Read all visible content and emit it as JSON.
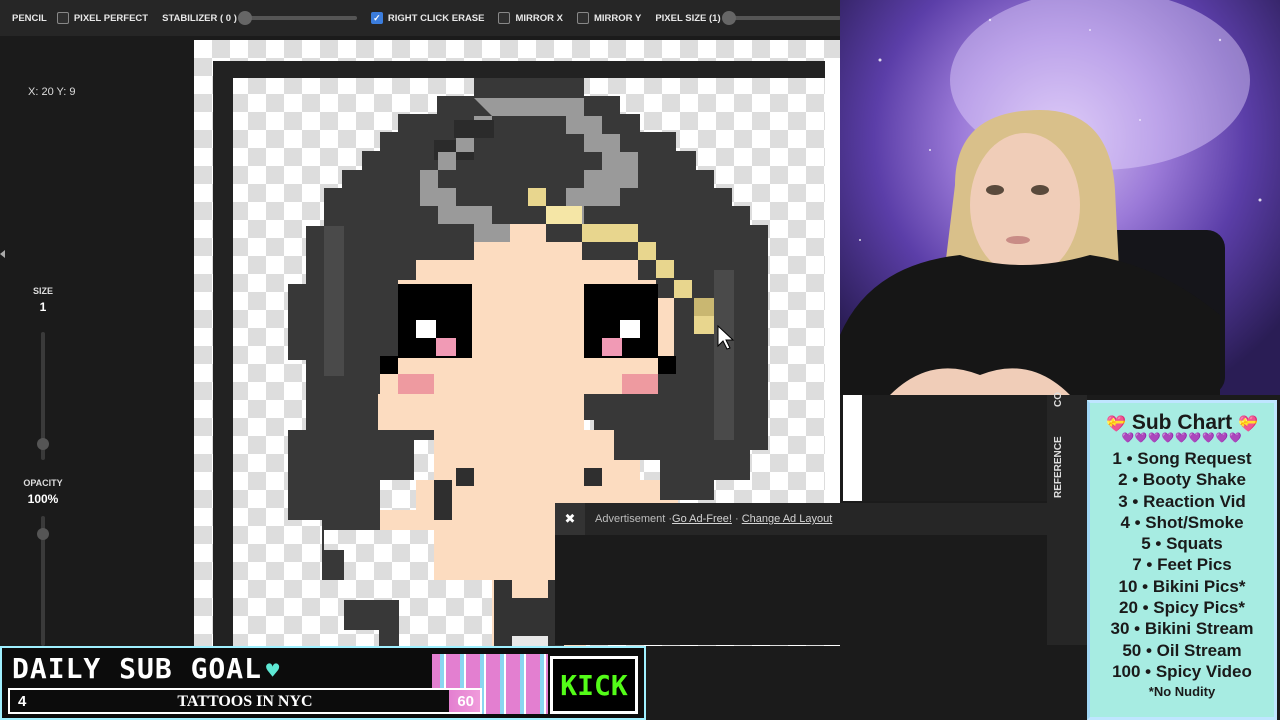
{
  "toolbar": {
    "tool_label": "PENCIL",
    "pixel_perfect": "PIXEL PERFECT",
    "stabilizer": "STABILIZER ( 0 )",
    "right_click_erase": "RIGHT CLICK ERASE",
    "mirror_x": "MIRROR X",
    "mirror_y": "MIRROR Y",
    "pixel_size": "PIXEL SIZE (1)"
  },
  "leftpanel": {
    "coords": "X: 20 Y: 9",
    "size_label": "SIZE",
    "size_value": "1",
    "opacity_label": "OPACITY",
    "opacity_value": "100%"
  },
  "ad": {
    "close": "✖",
    "text": "Advertisement · ",
    "link1": "Go Ad-Free!",
    "sep": " · ",
    "link2": "Change Ad Layout"
  },
  "ref_tabs": {
    "tab1": "CO",
    "tab2": "REFERENCE"
  },
  "sub_chart": {
    "title": "Sub Chart",
    "hearts": "💜💜💜💜💜💜💜💜💜",
    "items": [
      "1 • Song Request",
      "2 • Booty Shake",
      "3 • Reaction Vid",
      "4 • Shot/Smoke",
      "5 • Squats",
      "7 • Feet Pics",
      "10 • Bikini Pics*",
      "20 • Spicy Pics*",
      "30 • Bikini Stream",
      "50 • Oil Stream",
      "100 • Spicy Video"
    ],
    "note": "*No Nudity"
  },
  "goal": {
    "title": "DAILY SUB GOAL",
    "current": "4",
    "text": "TATTOOS IN NYC",
    "max": "60",
    "progress": 0.067,
    "kick": "KICK"
  },
  "colors": {
    "accent": "#3b7ddd",
    "goal_pink": "#e37fd0",
    "kick_green": "#53fc18",
    "chart_bg": "#a7ece2"
  }
}
